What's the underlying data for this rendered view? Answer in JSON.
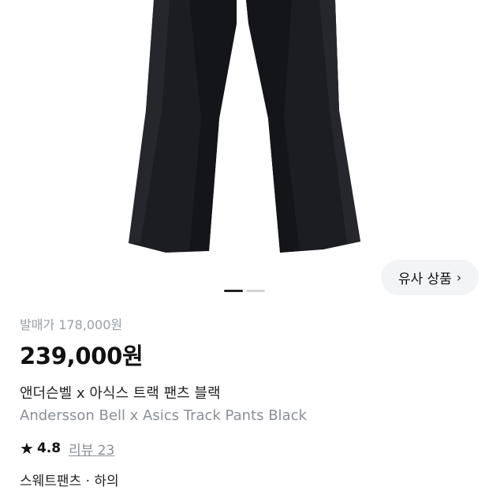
{
  "gallery": {
    "similar_button_label": "유사 상품",
    "total_images": 2,
    "current_index": 1
  },
  "product": {
    "release_price": "발매가 178,000원",
    "price": "239,000원",
    "name_ko": "앤더슨벨 x 아식스 트랙 팬츠 블랙",
    "name_en": "Andersson Bell x Asics Track Pants Black",
    "rating": "4.8",
    "review_label": "리뷰 23",
    "category": "스웨트팬츠 · 하의"
  },
  "colors": {
    "accent": "#111111",
    "muted": "#8a8f95",
    "pill_bg": "#f3f4f6"
  }
}
